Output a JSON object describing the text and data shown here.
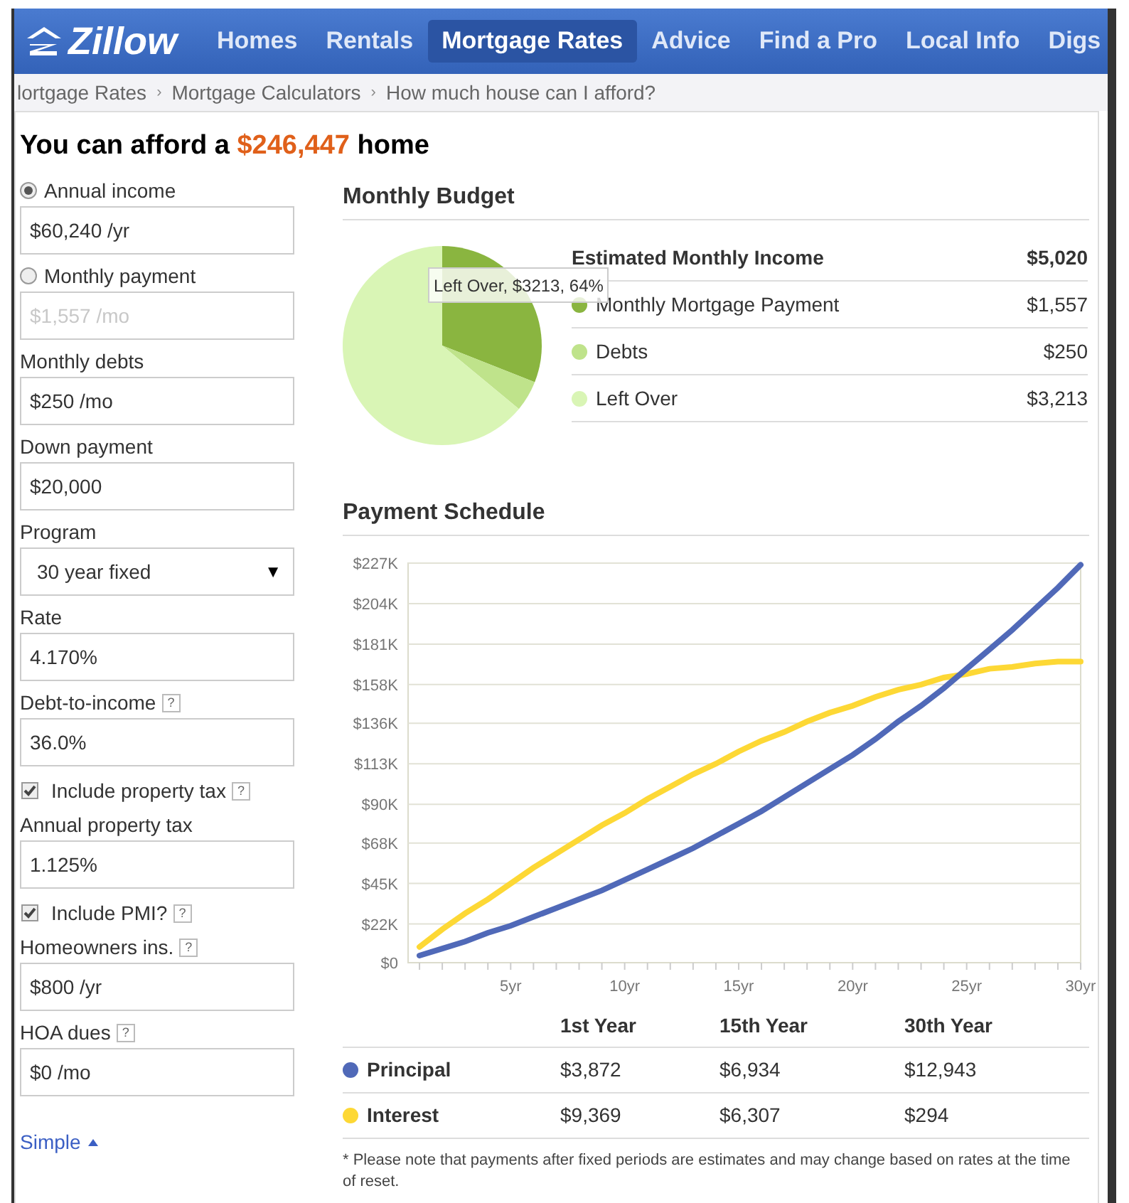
{
  "nav": {
    "logo": "Zillow",
    "items": [
      {
        "label": "Homes",
        "selected": false
      },
      {
        "label": "Rentals",
        "selected": false
      },
      {
        "label": "Mortgage Rates",
        "selected": true
      },
      {
        "label": "Advice",
        "selected": false
      },
      {
        "label": "Find a Pro",
        "selected": false
      },
      {
        "label": "Local Info",
        "selected": false
      },
      {
        "label": "Digs",
        "selected": false
      }
    ]
  },
  "breadcrumb": [
    {
      "label": "lortgage Rates",
      "separator": "›"
    },
    {
      "label": "Mortgage Calculators",
      "separator": "›"
    },
    {
      "label": "How much house can I afford?"
    }
  ],
  "headline": "You can afford a **$246,447** home",
  "form": [
    {
      "kind": "radio",
      "label": "Annual income",
      "selected": true,
      "value": "$60,240 /yr",
      "disabled": false
    },
    {
      "kind": "radio",
      "label": "Monthly payment",
      "selected": false,
      "value": "$1,557 /mo",
      "disabled": true
    },
    {
      "kind": "field",
      "label": "Monthly debts",
      "value": "$250 /mo"
    },
    {
      "kind": "field",
      "label": "Down payment",
      "value": "$20,000"
    },
    {
      "kind": "select",
      "label": "Program",
      "value": "30 year fixed",
      "caret": "▼"
    },
    {
      "kind": "field",
      "label": "Rate",
      "value": "4.170%"
    },
    {
      "kind": "field",
      "label": "Debt-to-income",
      "help": "?",
      "value": "36.0%"
    },
    {
      "kind": "checkbox",
      "label": "Include property tax",
      "help": "?",
      "checked": true
    },
    {
      "kind": "field",
      "label": "Annual property tax",
      "value": "1.125%"
    },
    {
      "kind": "checkbox",
      "label": "Include PMI?",
      "help": "?",
      "checked": true
    },
    {
      "kind": "field",
      "label": "Homeowners ins.",
      "help": "?",
      "value": "$800 /yr"
    },
    {
      "kind": "field",
      "label": "HOA dues",
      "help": "?",
      "value": "$0 /mo"
    }
  ],
  "simple_link": "Simple",
  "budget": {
    "title": "Monthly Budget",
    "header": {
      "label": "Estimated Monthly Income",
      "value": "$5,020"
    },
    "rows": [
      {
        "label": "Monthly Mortgage Payment",
        "value": "$1,557",
        "color": "#8ab540"
      },
      {
        "label": "Debts",
        "value": "$250",
        "color": "#bfe38b"
      },
      {
        "label": "Left Over",
        "value": "$3,213",
        "color": "#d9f5b5"
      }
    ],
    "tooltip": "Left Over, $3213, 64%",
    "chart_data": {
      "type": "pie",
      "values": [
        31,
        5,
        64
      ]
    }
  },
  "schedule": {
    "title": "Payment Schedule",
    "chart_data": {
      "type": "line",
      "x": [
        1,
        2,
        3,
        4,
        5,
        6,
        7,
        8,
        9,
        10,
        11,
        12,
        13,
        14,
        15,
        16,
        17,
        18,
        19,
        20,
        21,
        22,
        23,
        24,
        25,
        26,
        27,
        28,
        29,
        30
      ],
      "series": [
        {
          "name": "Principal",
          "color": "#5069b8",
          "values": [
            4,
            8,
            12,
            17,
            21,
            26,
            31,
            36,
            41,
            47,
            53,
            59,
            65,
            72,
            79,
            86,
            94,
            102,
            110,
            118,
            127,
            137,
            146,
            156,
            167,
            178,
            189,
            201,
            213,
            226
          ]
        },
        {
          "name": "Interest",
          "color": "#fdd835",
          "values": [
            9,
            19,
            28,
            36,
            45,
            54,
            62,
            70,
            78,
            85,
            93,
            100,
            107,
            113,
            120,
            126,
            131,
            137,
            142,
            146,
            151,
            155,
            158,
            162,
            164,
            167,
            168,
            170,
            171,
            171
          ]
        }
      ],
      "xlim": [
        0.5,
        30
      ],
      "ylim": [
        0,
        227
      ],
      "grid": true,
      "xticks": [
        {
          "value": 5,
          "label": "5yr"
        },
        {
          "value": 10,
          "label": "10yr"
        },
        {
          "value": 15,
          "label": "15yr"
        },
        {
          "value": 20,
          "label": "20yr"
        },
        {
          "value": 25,
          "label": "25yr"
        },
        {
          "value": 30,
          "label": "30yr"
        }
      ],
      "yticks": [
        {
          "value": 0,
          "label": "$0"
        },
        {
          "value": 22,
          "label": "$22K"
        },
        {
          "value": 45,
          "label": "$45K"
        },
        {
          "value": 68,
          "label": "$68K"
        },
        {
          "value": 90,
          "label": "$90K"
        },
        {
          "value": 113,
          "label": "$113K"
        },
        {
          "value": 136,
          "label": "$136K"
        },
        {
          "value": 158,
          "label": "$158K"
        },
        {
          "value": 181,
          "label": "$181K"
        },
        {
          "value": 204,
          "label": "$204K"
        },
        {
          "value": 227,
          "label": "$227K"
        }
      ]
    },
    "table": {
      "columns": [
        "1st Year",
        "15th Year",
        "30th Year"
      ],
      "rows": [
        {
          "cells": [
            "$3,872",
            "$6,934",
            "$12,943"
          ]
        },
        {
          "cells": [
            "$9,369",
            "$6,307",
            "$294"
          ]
        }
      ]
    },
    "note": "* Please note that payments after fixed periods are estimates and may change based on rates at the time of reset."
  }
}
